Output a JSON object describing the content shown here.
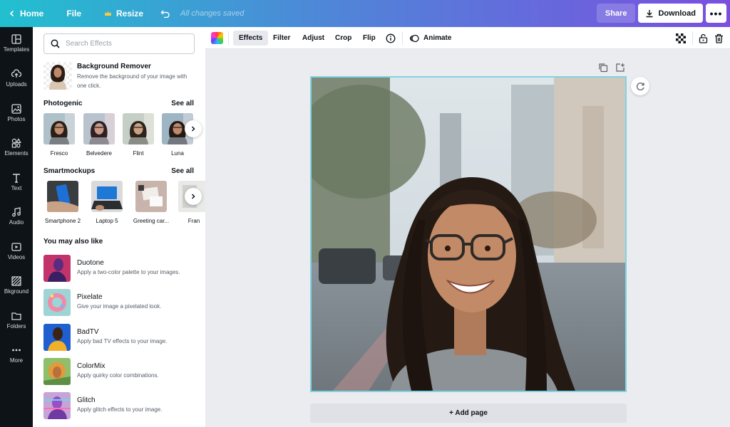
{
  "topbar": {
    "home": "Home",
    "file": "File",
    "resize": "Resize",
    "saved_status": "All changes saved",
    "share": "Share",
    "download": "Download",
    "more": "•••"
  },
  "rail": [
    {
      "label": "Templates",
      "icon": "layout-icon"
    },
    {
      "label": "Uploads",
      "icon": "upload-icon"
    },
    {
      "label": "Photos",
      "icon": "image-icon"
    },
    {
      "label": "Elements",
      "icon": "shapes-icon"
    },
    {
      "label": "Text",
      "icon": "text-icon"
    },
    {
      "label": "Audio",
      "icon": "music-icon"
    },
    {
      "label": "Videos",
      "icon": "video-icon"
    },
    {
      "label": "Bkground",
      "icon": "pattern-icon"
    },
    {
      "label": "Folders",
      "icon": "folder-icon"
    },
    {
      "label": "More",
      "icon": "more-icon"
    }
  ],
  "panel": {
    "search_placeholder": "Search Effects",
    "bg_remover": {
      "title": "Background Remover",
      "desc": "Remove the background of your image with one click."
    },
    "photogenic": {
      "title": "Photogenic",
      "see_all": "See all",
      "items": [
        "Fresco",
        "Belvedere",
        "Flint",
        "Luna"
      ]
    },
    "smartmockups": {
      "title": "Smartmockups",
      "see_all": "See all",
      "items": [
        "Smartphone 2",
        "Laptop 5",
        "Greeting car...",
        "Fran"
      ]
    },
    "also_like": {
      "title": "You may also like",
      "items": [
        {
          "title": "Duotone",
          "desc": "Apply a two-color palette to your images."
        },
        {
          "title": "Pixelate",
          "desc": "Give your image a pixelated look."
        },
        {
          "title": "BadTV",
          "desc": "Apply bad TV effects to your image."
        },
        {
          "title": "ColorMix",
          "desc": "Apply quirky color combinations."
        },
        {
          "title": "Glitch",
          "desc": "Apply glitch effects to your image."
        }
      ]
    }
  },
  "toolbar": {
    "effects": "Effects",
    "filter": "Filter",
    "adjust": "Adjust",
    "crop": "Crop",
    "flip": "Flip",
    "animate": "Animate"
  },
  "canvas": {
    "add_page": "+ Add page"
  },
  "colors": {
    "accent_cyan": "#21c0cf",
    "accent_purple": "#7a4fe0",
    "rail_bg": "#0e1318",
    "selection_border": "#7fd3e3"
  }
}
